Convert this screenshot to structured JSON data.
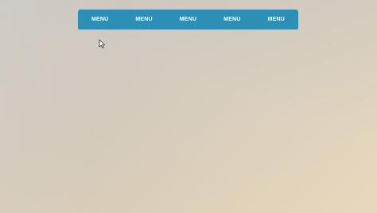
{
  "menu": {
    "items": [
      {
        "label": "MENU"
      },
      {
        "label": "MENU"
      },
      {
        "label": "MENU"
      },
      {
        "label": "MENU"
      },
      {
        "label": "MENU"
      }
    ],
    "background_color": "#2d8eb6",
    "text_color": "#ffffff"
  },
  "cursor": {
    "icon": "mouse-pointer-icon"
  }
}
